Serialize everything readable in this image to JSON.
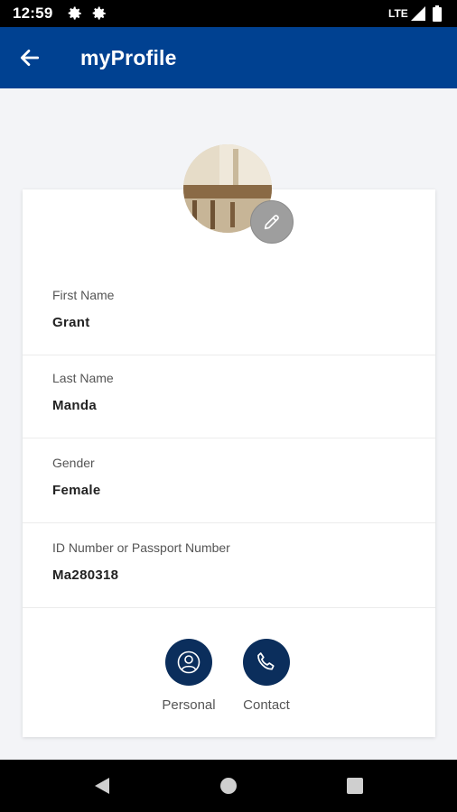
{
  "status_bar": {
    "time": "12:59",
    "network": "LTE"
  },
  "app_bar": {
    "title": "myProfile"
  },
  "profile": {
    "fields": [
      {
        "label": "First Name",
        "value": "Grant"
      },
      {
        "label": "Last Name",
        "value": "Manda"
      },
      {
        "label": "Gender",
        "value": "Female"
      },
      {
        "label": "ID Number or Passport Number",
        "value": "Ma280318"
      }
    ]
  },
  "actions": [
    {
      "label": "Personal",
      "icon": "person-icon"
    },
    {
      "label": "Contact",
      "icon": "phone-icon"
    }
  ],
  "colors": {
    "app_bar": "#004191",
    "action_button": "#0b2e5c",
    "background": "#f3f4f7"
  }
}
